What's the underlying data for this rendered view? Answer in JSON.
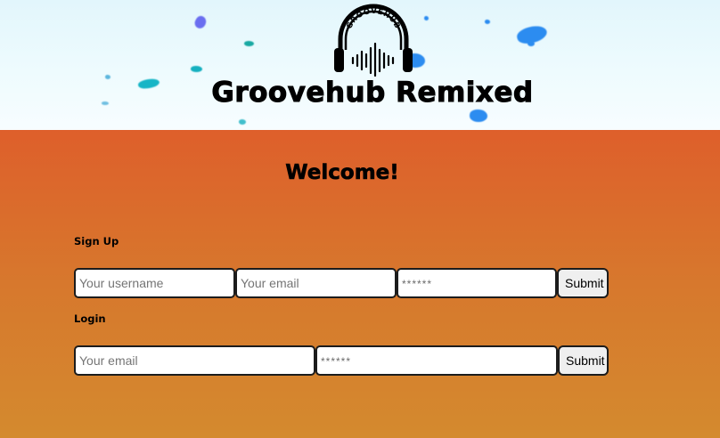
{
  "header": {
    "logo_text": "GROOVEHUB",
    "title": "Groovehub Remixed"
  },
  "main": {
    "welcome": "Welcome!",
    "signup": {
      "label": "Sign Up",
      "username_placeholder": "Your username",
      "email_placeholder": "Your email",
      "password_placeholder": "******",
      "submit_label": "Submit"
    },
    "login": {
      "label": "Login",
      "email_placeholder": "Your email",
      "password_placeholder": "******",
      "submit_label": "Submit"
    }
  },
  "colors": {
    "header_bg": "#e8f8fd",
    "main_bg_top": "#de5f2b",
    "main_bg_bottom": "#d48a2e",
    "blob_teal": "#18b4c4",
    "blob_blue": "#2c8cf0",
    "blob_purple": "#6a6ef0"
  }
}
